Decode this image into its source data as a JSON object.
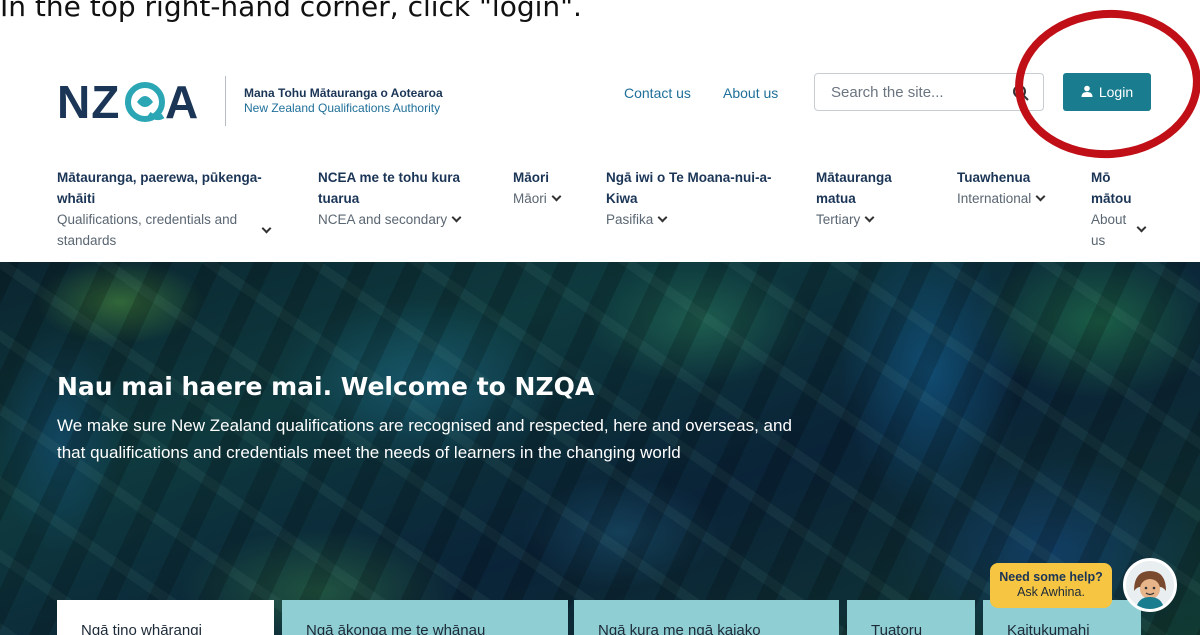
{
  "instruction": "In the top right-hand corner, click \"login\".",
  "header": {
    "logo_text": "NZQA",
    "org_name_maori": "Mana Tohu Mātauranga o Aotearoa",
    "org_name_english": "New Zealand Qualifications Authority",
    "contact_link": "Contact us",
    "about_link": "About us",
    "search_placeholder": "Search the site...",
    "login_label": "Login"
  },
  "nav": [
    {
      "maori": "Mātauranga, paerewa, pūkenga-whāiti",
      "english": "Qualifications, credentials and standards"
    },
    {
      "maori": "NCEA me te tohu kura tuarua",
      "english": "NCEA and secondary"
    },
    {
      "maori": "Māori",
      "english": "Māori"
    },
    {
      "maori": "Ngā iwi o Te Moana-nui-a-Kiwa",
      "english": "Pasifika"
    },
    {
      "maori": "Mātauranga matua",
      "english": "Tertiary"
    },
    {
      "maori": "Tuawhenua",
      "english": "International"
    },
    {
      "maori": "Mō mātou",
      "english": "About us"
    }
  ],
  "hero": {
    "title": "Nau mai haere mai. Welcome to NZQA",
    "text": "We make sure New Zealand qualifications are recognised and respected, here and overseas, and that qualifications and credentials meet the needs of learners in the changing world"
  },
  "tiles": [
    "Ngā tino whārangi",
    "Ngā ākonga me te whānau",
    "Ngā kura me ngā kaiako",
    "Tuatoru",
    "Kaitukumahi"
  ],
  "help": {
    "line1": "Need some help?",
    "line2": "Ask Awhina."
  },
  "colors": {
    "brand_navy": "#1b3556",
    "link_blue": "#1f6f99",
    "login_teal": "#1a7c8f",
    "tile_teal": "#8fcfd4",
    "annotation_red": "#c00f17",
    "help_yellow": "#f6c542"
  }
}
